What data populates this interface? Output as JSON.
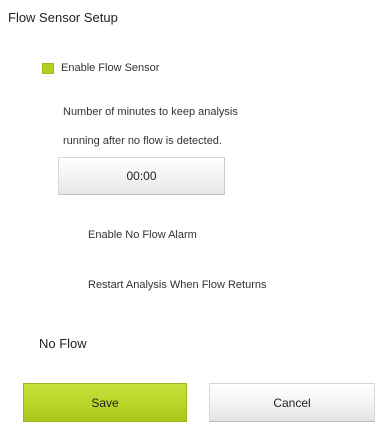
{
  "title": "Flow Sensor Setup",
  "enable_flow_sensor": {
    "label": "Enable Flow Sensor",
    "checked": true,
    "color": "#b5cf24"
  },
  "minutes": {
    "line1": "Number of minutes to keep analysis",
    "line2": "running after no flow is detected.",
    "value": "00:00"
  },
  "options": {
    "no_flow_alarm": "Enable No Flow Alarm",
    "restart_analysis": "Restart Analysis When Flow Returns"
  },
  "status": "No Flow",
  "buttons": {
    "save": "Save",
    "cancel": "Cancel",
    "save_color": "#b9d427"
  }
}
